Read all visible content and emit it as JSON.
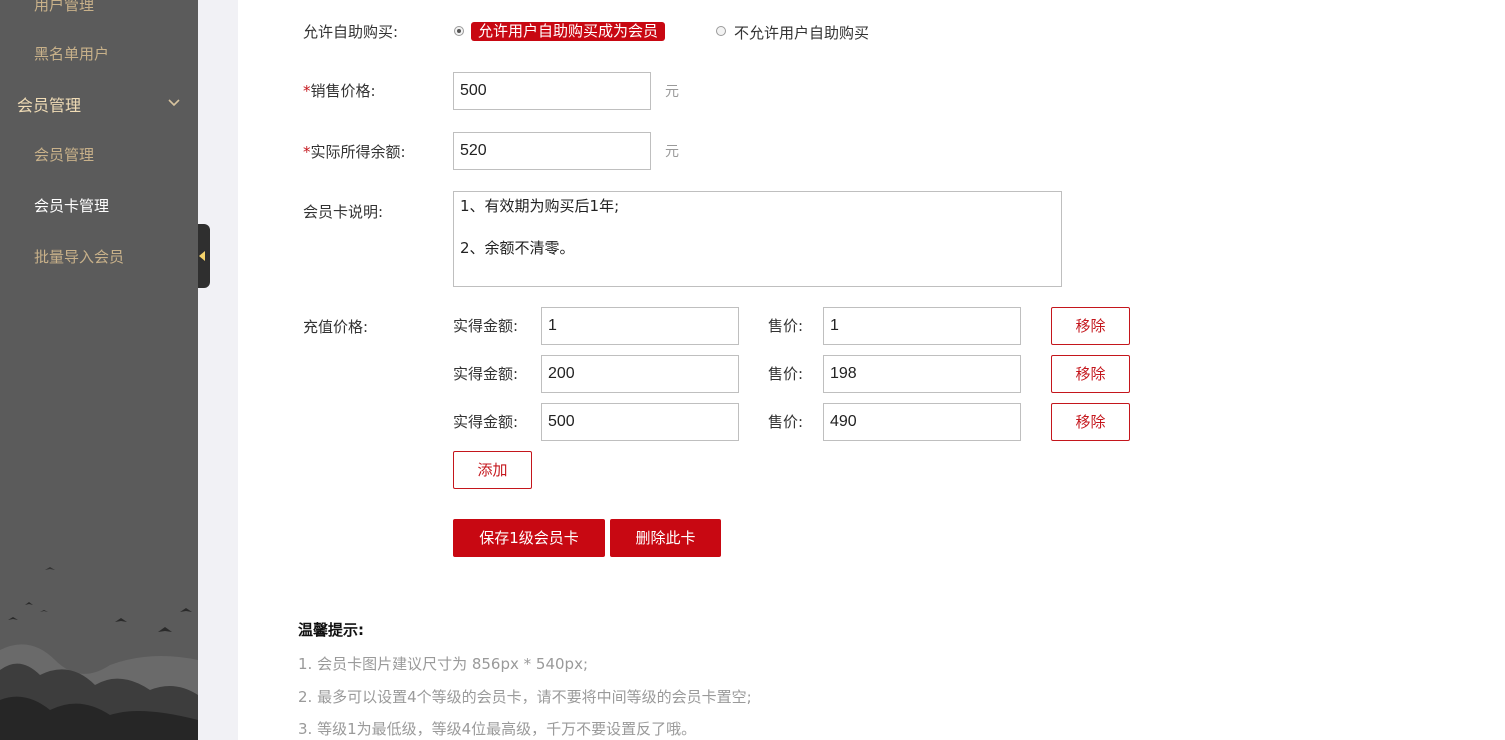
{
  "sidebar": {
    "items": [
      {
        "label": "用户管理",
        "type": "item"
      },
      {
        "label": "黑名单用户",
        "type": "item"
      },
      {
        "label": "会员管理",
        "type": "group"
      },
      {
        "label": "会员管理",
        "type": "item"
      },
      {
        "label": "会员卡管理",
        "type": "item",
        "active": true
      },
      {
        "label": "批量导入会员",
        "type": "item"
      }
    ]
  },
  "form": {
    "purchase": {
      "label": "允许自助购买:",
      "options": [
        {
          "label": "允许用户自助购买成为会员",
          "checked": true
        },
        {
          "label": "不允许用户自助购买",
          "checked": false
        }
      ]
    },
    "sale_price": {
      "required_mark": "*",
      "label": "销售价格:",
      "value": "500",
      "unit": "元"
    },
    "actual_balance": {
      "required_mark": "*",
      "label": "实际所得余额:",
      "value": "520",
      "unit": "元"
    },
    "description": {
      "label": "会员卡说明:",
      "lines": [
        "1、有效期为购买后1年;",
        "",
        "2、余额不清零。"
      ]
    },
    "recharge": {
      "label": "充值价格:",
      "amount_label": "实得金额:",
      "price_label": "售价:",
      "remove_label": "移除",
      "rows": [
        {
          "amount": "1",
          "price": "1"
        },
        {
          "amount": "200",
          "price": "198"
        },
        {
          "amount": "500",
          "price": "490"
        }
      ],
      "add_label": "添加"
    },
    "save_label": "保存1级会员卡",
    "delete_label": "删除此卡"
  },
  "tips": {
    "title": "温馨提示:",
    "items": [
      "1. 会员卡图片建议尺寸为 856px * 540px;",
      "2. 最多可以设置4个等级的会员卡，请不要将中间等级的会员卡置空;",
      "3. 等级1为最低级，等级4位最高级，千万不要设置反了哦。"
    ]
  },
  "colors": {
    "accent": "#c80812",
    "sidebar_bg": "#5b5b5b",
    "sidebar_text": "#c8b18a"
  }
}
